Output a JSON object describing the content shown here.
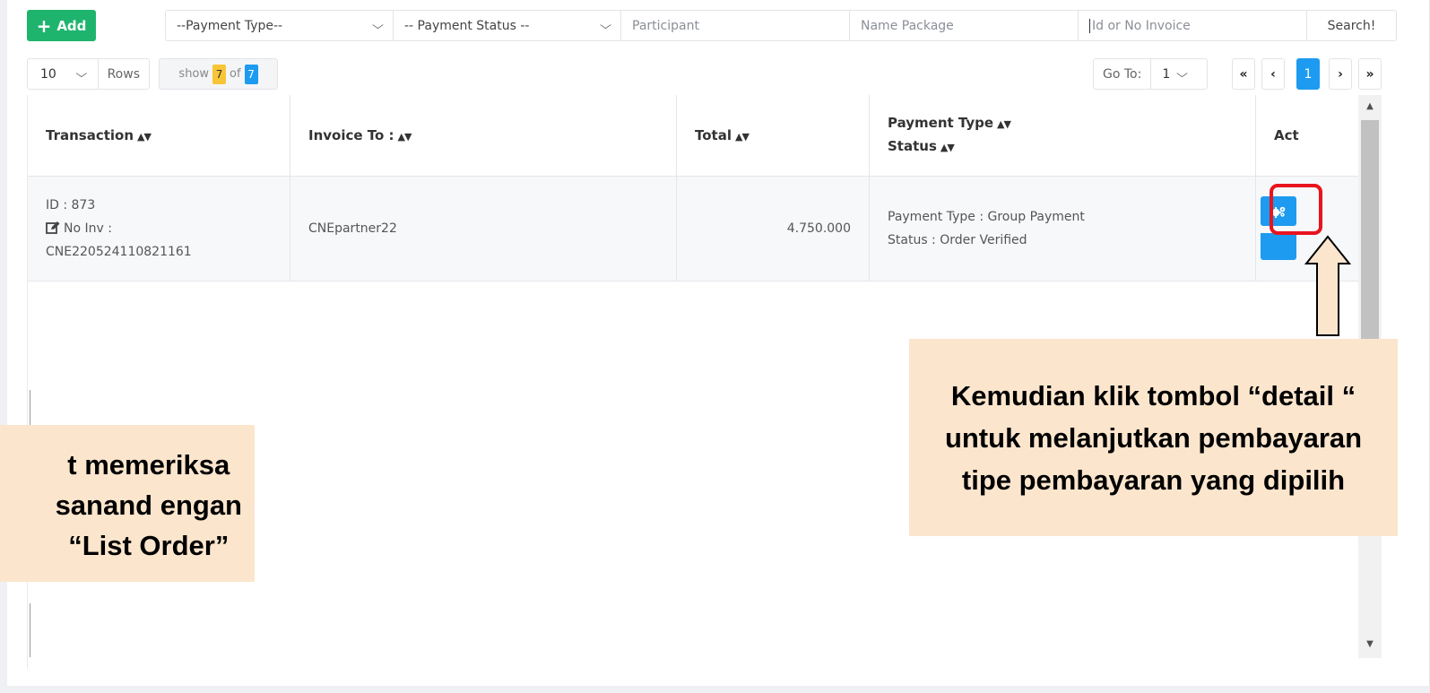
{
  "toolbar": {
    "add_label": "Add",
    "payment_type_select": "--Payment Type--",
    "payment_status_select": "-- Payment Status --",
    "participant_placeholder": "Participant",
    "package_placeholder": "Name Package",
    "invoice_placeholder": "Id or No Invoice",
    "search_label": "Search!"
  },
  "list_controls": {
    "rows_value": "10",
    "rows_label": "Rows",
    "show_label": "show",
    "show_count": "7",
    "of_label": "of",
    "total_count": "7",
    "goto_label": "Go To:",
    "goto_value": "1",
    "page_first": "«",
    "page_prev": "‹",
    "page_current": "1",
    "page_next": "›",
    "page_last": "»"
  },
  "table": {
    "headers": {
      "transaction": "Transaction",
      "invoice_to": "Invoice To :",
      "total": "Total",
      "payment_type": "Payment Type",
      "status": "Status",
      "act": "Act"
    },
    "rows": [
      {
        "id_line": "ID : 873",
        "no_inv_label": "No Inv :",
        "invoice_no": "CNE220524110821161",
        "invoice_to": "CNEpartner22",
        "total": "4.750.000",
        "payment_type_line": "Payment Type : Group Payment",
        "status_line": "Status : Order Verified"
      }
    ]
  },
  "annotations": {
    "right_note": "Kemudian klik tombol “detail “ untuk melanjutkan pembayaran tipe pembayaran yang dipilih",
    "left_note_line1": "t memeriksa",
    "left_note_line2": "sanand engan",
    "left_note_line3": "“List Order”"
  },
  "icons": {
    "add": "plus-icon",
    "edit": "edit-icon",
    "action": "gears-icon",
    "arrow": "up-arrow-icon"
  },
  "colors": {
    "add_button": "#1fb46e",
    "primary_blue": "#1d9bf0",
    "highlight_red": "#e8141d",
    "note_bg": "#fbe5cd",
    "badge_yellow": "#f8c537"
  }
}
